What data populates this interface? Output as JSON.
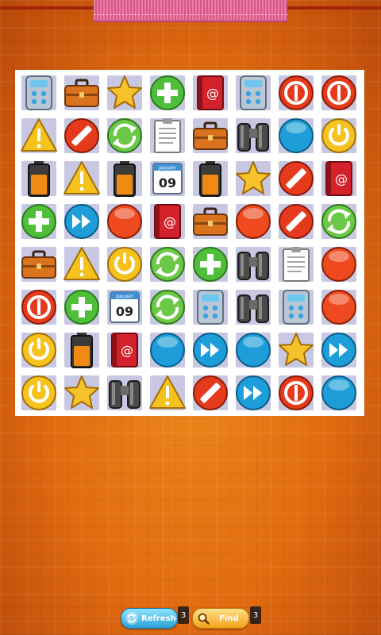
{
  "board": {
    "rows": [
      [
        "calculator",
        "briefcase",
        "star",
        "plus",
        "address-book",
        "calculator",
        "stop",
        "stop"
      ],
      [
        "warning",
        "no-entry",
        "refresh",
        "clipboard",
        "briefcase",
        "binoculars",
        "blue-orb",
        "power"
      ],
      [
        "battery",
        "warning",
        "battery",
        "calendar",
        "battery",
        "star",
        "no-entry",
        "address-book"
      ],
      [
        "plus",
        "fast-forward",
        "red-orb",
        "address-book",
        "briefcase",
        "red-orb",
        "no-entry",
        "refresh"
      ],
      [
        "briefcase",
        "warning",
        "power",
        "refresh",
        "plus",
        "binoculars",
        "clipboard",
        "red-orb"
      ],
      [
        "stop",
        "plus",
        "calendar",
        "refresh",
        "calculator",
        "binoculars",
        "calculator",
        "red-orb"
      ],
      [
        "power",
        "battery",
        "address-book",
        "blue-orb",
        "fast-forward",
        "blue-orb",
        "star",
        "fast-forward"
      ],
      [
        "power",
        "star",
        "binoculars",
        "warning",
        "no-entry",
        "fast-forward",
        "stop",
        "blue-orb"
      ]
    ],
    "calendar_month": "JANUARY",
    "calendar_day": "09",
    "email_symbol": "@"
  },
  "controls": {
    "refresh_label": "Refresh",
    "refresh_count": "3",
    "find_label": "Find",
    "find_count": "3"
  },
  "colors": {
    "background": "#e57416",
    "board": "#ffffff",
    "cell": "#c9c8e3",
    "top_panel": "#d95688"
  }
}
